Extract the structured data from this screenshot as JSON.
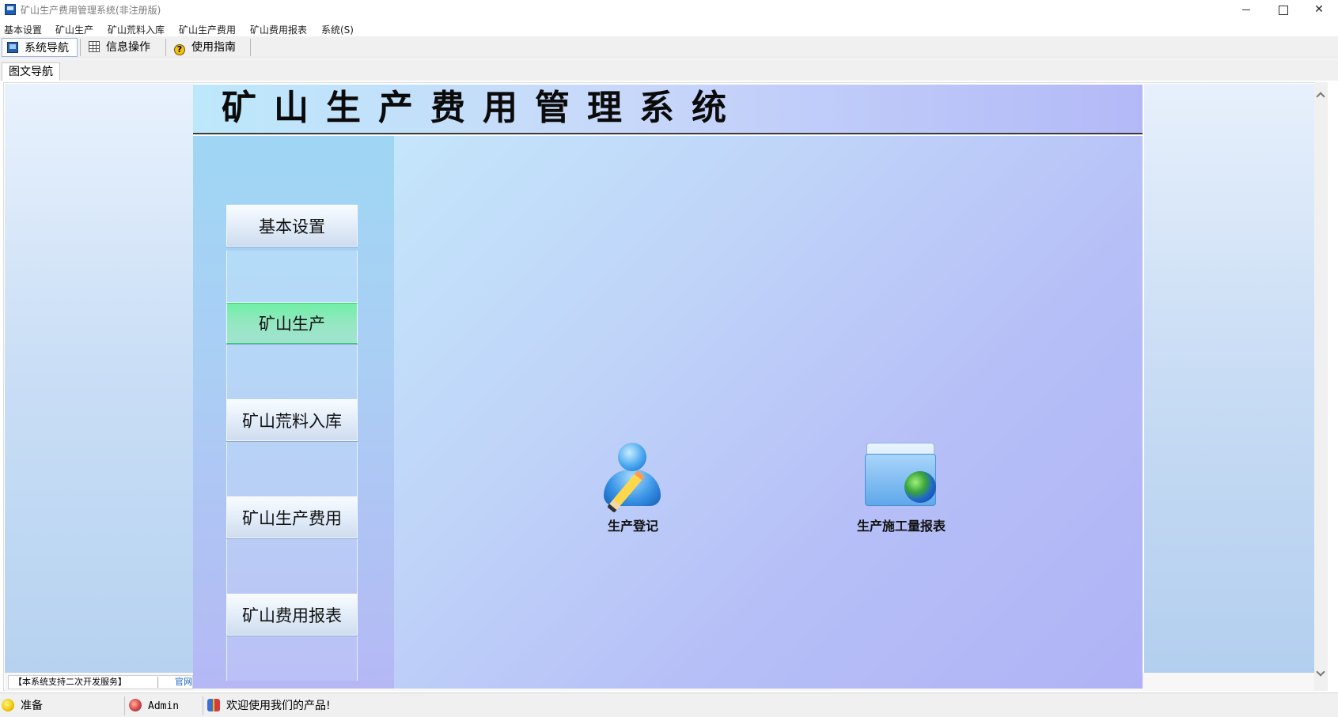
{
  "window": {
    "title": "矿山生产费用管理系统(非注册版)"
  },
  "menu": [
    {
      "label": "基本设置"
    },
    {
      "label": "矿山生产"
    },
    {
      "label": "矿山荒料入库"
    },
    {
      "label": "矿山生产费用"
    },
    {
      "label": "矿山费用报表"
    },
    {
      "label": "系统(S)"
    }
  ],
  "toolbar": {
    "nav_label": "系统导航",
    "info_label": "信息操作",
    "guide_label": "使用指南"
  },
  "tabs": [
    {
      "label": "图文导航"
    }
  ],
  "board": {
    "title": "矿山生产费用管理系统",
    "nav": [
      {
        "label": "基本设置"
      },
      {
        "label": "矿山生产",
        "active": true
      },
      {
        "label": "矿山荒料入库"
      },
      {
        "label": "矿山生产费用"
      },
      {
        "label": "矿山费用报表"
      }
    ],
    "tiles": [
      {
        "label": "生产登记",
        "icon": "user-edit-icon"
      },
      {
        "label": "生产施工量报表",
        "icon": "folder-globe-icon"
      }
    ]
  },
  "left_footer": {
    "service": "【本系统支持二次开发服务】",
    "site": "官网"
  },
  "status": {
    "state": "准备",
    "user": "Admin",
    "message": "欢迎使用我们的产品!"
  },
  "colors": {
    "active_nav": "#7dedb0",
    "header_bg": "#c3dcfa",
    "link": "#1565c0"
  }
}
